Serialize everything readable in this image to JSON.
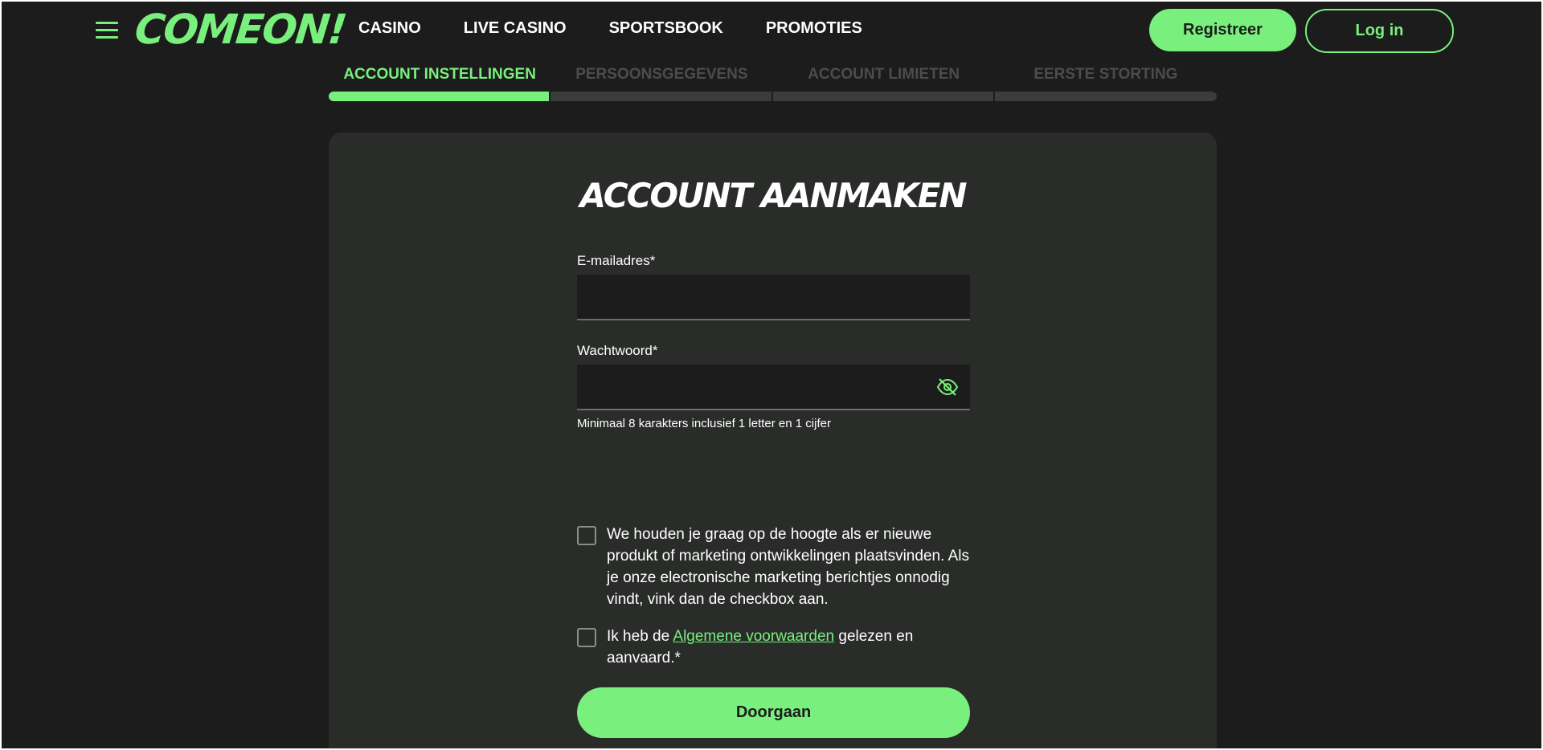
{
  "header": {
    "logo": "COMEON!",
    "nav": [
      "CASINO",
      "LIVE CASINO",
      "SPORTSBOOK",
      "PROMOTIES"
    ],
    "register_label": "Registreer",
    "login_label": "Log in"
  },
  "steps": {
    "items": [
      "ACCOUNT INSTELLINGEN",
      "PERSOONSGEGEVENS",
      "ACCOUNT LIMIETEN",
      "EERSTE STORTING"
    ],
    "active_index": 0,
    "progress": 0.25
  },
  "form": {
    "title": "ACCOUNT AANMAKEN",
    "email_label": "E-mailadres*",
    "email_value": "",
    "password_label": "Wachtwoord*",
    "password_value": "",
    "password_hint": "Minimaal 8 karakters inclusief 1 letter en 1 cijfer",
    "marketing_text": "We houden je graag op de hoogte als er nieuwe produkt of marketing ontwikkelingen plaatsvinden. Als je onze electronische marketing berichtjes onnodig vindt, vink dan de checkbox aan.",
    "marketing_checked": false,
    "terms_prefix": "Ik heb de ",
    "terms_link": "Algemene voorwaarden",
    "terms_suffix": " gelezen en aanvaard.*",
    "terms_checked": false,
    "continue_label": "Doorgaan"
  },
  "colors": {
    "accent": "#79ef7d",
    "background": "#1b1c1b",
    "card": "#2a2c2a"
  },
  "icons": {
    "menu": "hamburger-icon",
    "password_toggle": "eye-off-icon"
  }
}
